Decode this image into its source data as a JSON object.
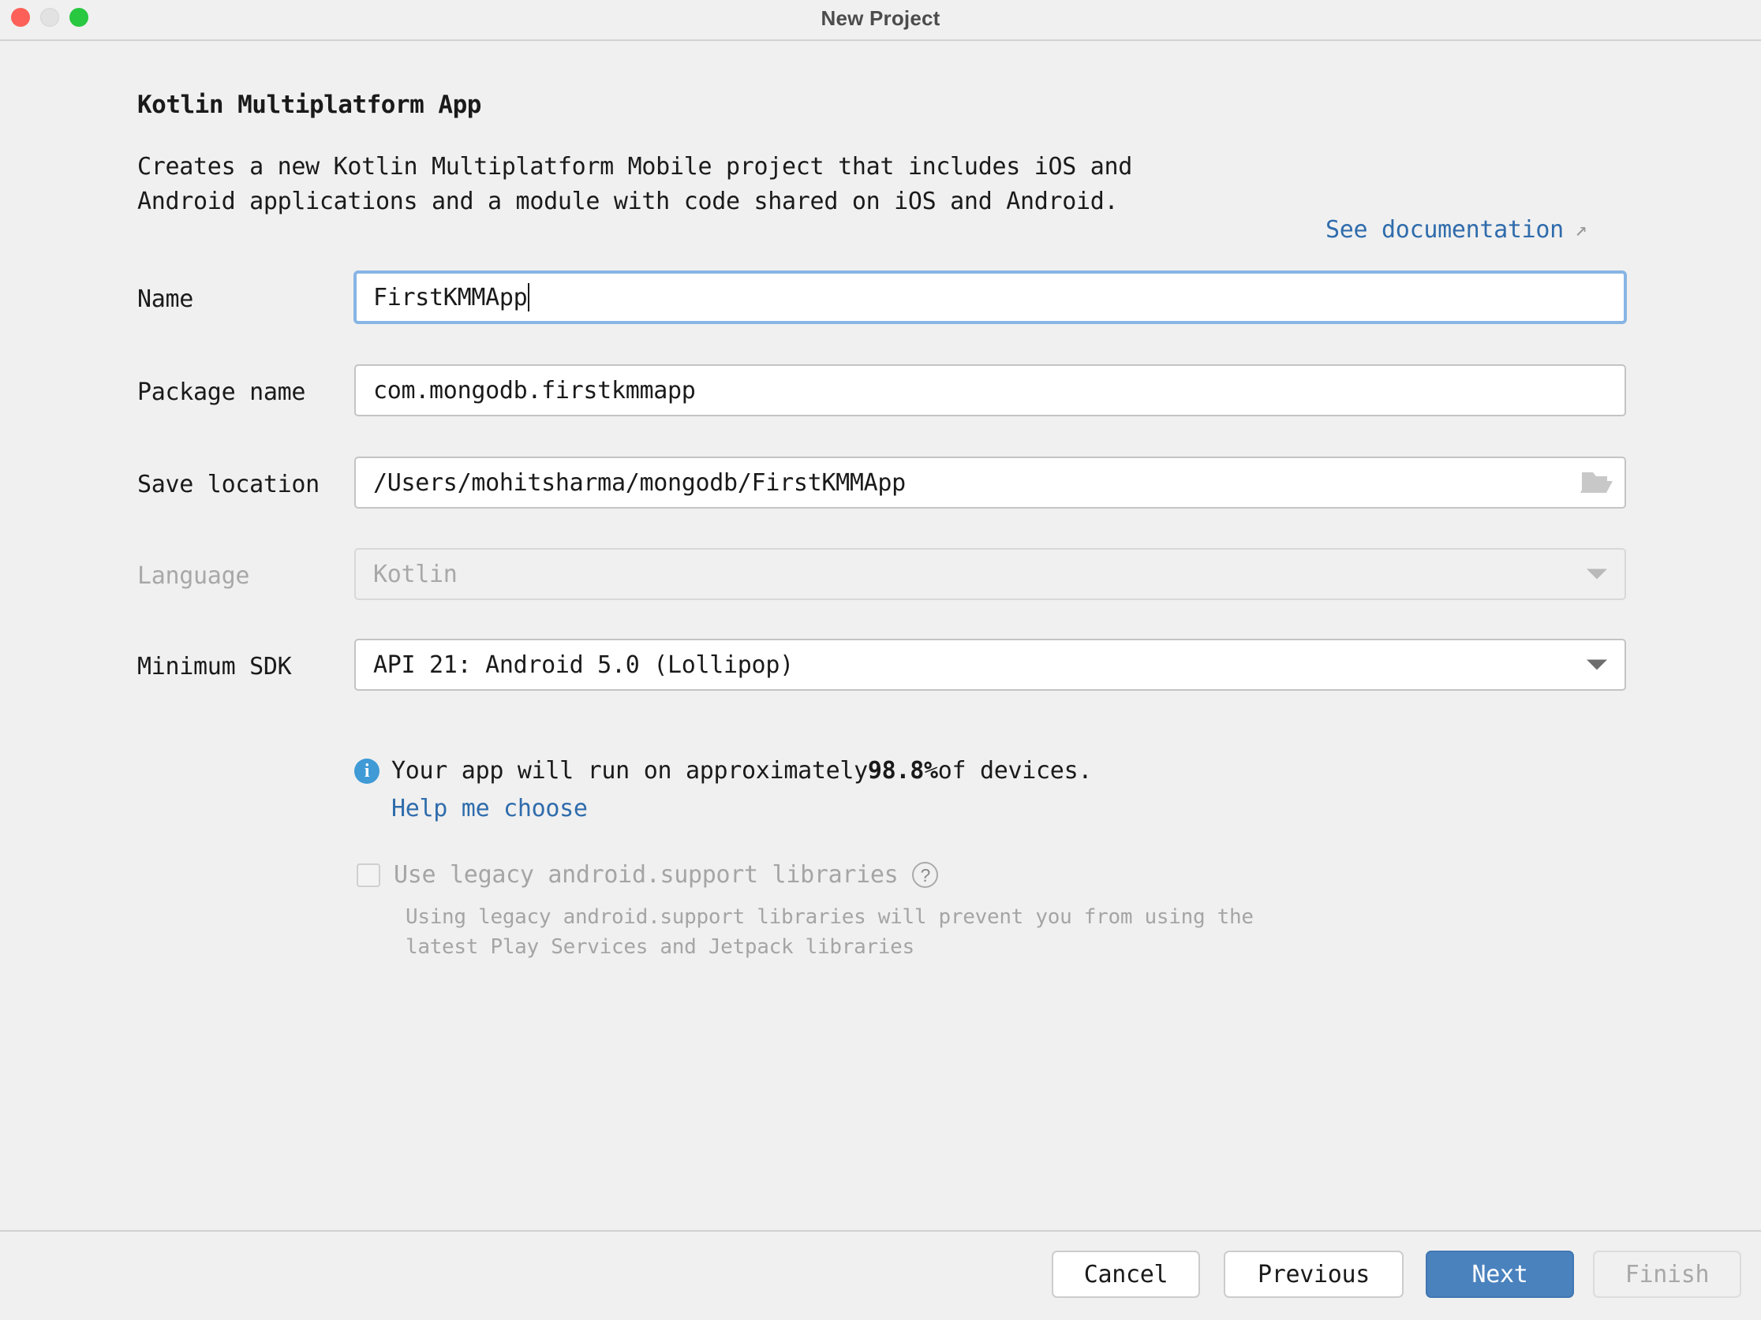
{
  "window": {
    "title": "New Project",
    "controls": {
      "close": "close-window",
      "minimize": "minimize-window",
      "maximize": "maximize-window"
    }
  },
  "page": {
    "title": "Kotlin Multiplatform App",
    "description": "Creates a new Kotlin Multiplatform Mobile project that includes iOS and Android applications and a module with code shared on iOS and Android.",
    "doc_link": "See documentation",
    "doc_link_arrow": "↗"
  },
  "form": {
    "name": {
      "label": "Name",
      "value": "FirstKMMApp"
    },
    "package_name": {
      "label": "Package name",
      "value": "com.mongodb.firstkmmapp"
    },
    "save_location": {
      "label": "Save location",
      "value": "/Users/mohitsharma/mongodb/FirstKMMApp",
      "browse_icon": "folder-icon"
    },
    "language": {
      "label": "Language",
      "value": "Kotlin",
      "disabled": true
    },
    "minimum_sdk": {
      "label": "Minimum SDK",
      "value": "API 21: Android 5.0 (Lollipop)"
    }
  },
  "info": {
    "icon": "info-icon",
    "text_before": "Your app will run on approximately ",
    "percent": "98.8%",
    "text_after": " of devices.",
    "help_link": "Help me choose"
  },
  "legacy": {
    "checkbox_label": "Use legacy android.support libraries",
    "help_icon": "question-mark-icon",
    "description": "Using legacy android.support libraries will prevent you from using the latest Play Services and Jetpack libraries",
    "checked": false,
    "disabled": true
  },
  "footer": {
    "cancel": "Cancel",
    "previous": "Previous",
    "next": "Next",
    "finish": "Finish"
  },
  "colors": {
    "background": "#f0f0f0",
    "accent_blue": "#4a82be",
    "link_blue": "#2f6cac",
    "info_blue": "#3f9ad6",
    "focus_border": "#87b5e4",
    "traffic_close": "#fc6058",
    "traffic_minimize": "#e2e2e2",
    "traffic_maximize": "#28c840",
    "disabled_text": "#a8a8a8"
  }
}
